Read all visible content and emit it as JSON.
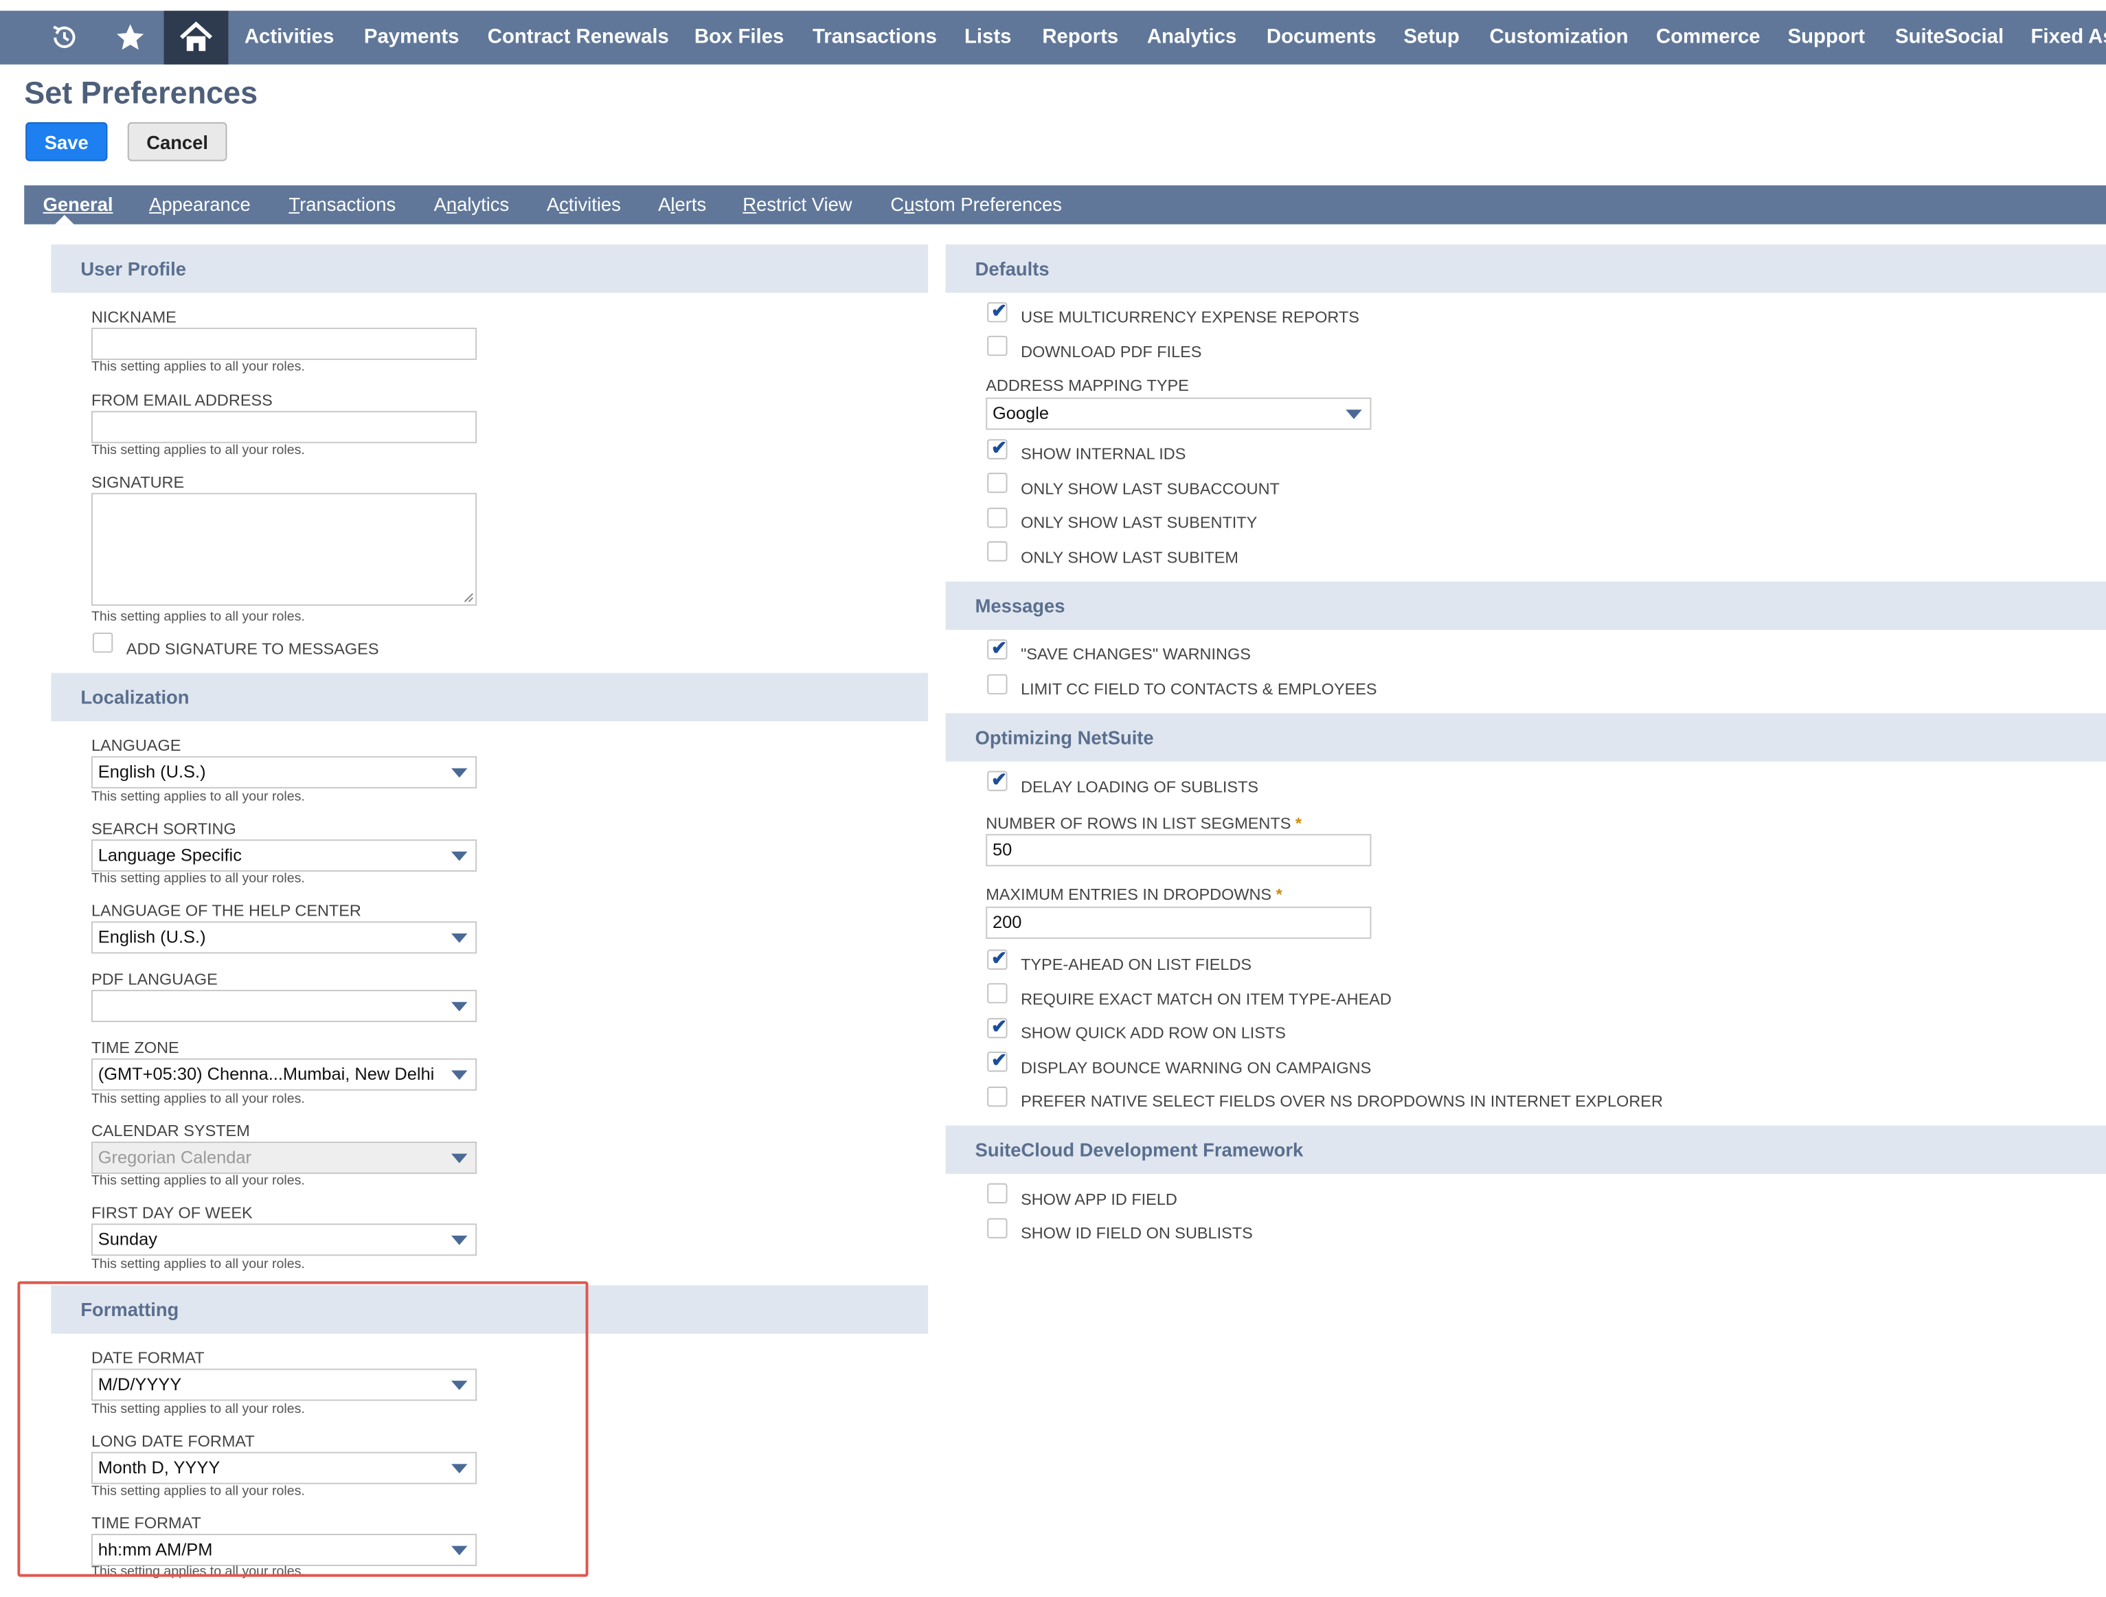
{
  "nav": {
    "icons": [
      "recent-icon",
      "star-icon",
      "home-icon"
    ],
    "items": [
      "Activities",
      "Payments",
      "Contract Renewals",
      "Box Files",
      "Transactions",
      "Lists",
      "Reports",
      "Analytics",
      "Documents",
      "Setup",
      "Customization",
      "Commerce",
      "Support",
      "SuiteSocial",
      "Fixed As"
    ]
  },
  "page": {
    "title": "Set Preferences",
    "save_label": "Save",
    "cancel_label": "Cancel"
  },
  "tabs": [
    {
      "label": "General",
      "underline": "G",
      "rest": "eneral",
      "active": true
    },
    {
      "label": "Appearance",
      "underline": "A",
      "rest": "ppearance"
    },
    {
      "label": "Transactions",
      "underline": "T",
      "rest": "ransactions"
    },
    {
      "label": "Analytics",
      "pre": "A",
      "underline": "n",
      "rest": "alytics"
    },
    {
      "label": "Activities",
      "pre": "A",
      "underline": "c",
      "rest": "tivities"
    },
    {
      "label": "Alerts",
      "pre": "A",
      "underline": "l",
      "rest": "erts"
    },
    {
      "label": "Restrict View",
      "underline": "R",
      "rest": "estrict View"
    },
    {
      "label": "Custom Preferences",
      "pre": "C",
      "underline": "u",
      "rest": "stom Preferences"
    }
  ],
  "sections": {
    "user_profile": "User Profile",
    "localization": "Localization",
    "formatting": "Formatting",
    "defaults": "Defaults",
    "messages": "Messages",
    "optimizing": "Optimizing NetSuite",
    "suitecloud": "SuiteCloud Development Framework"
  },
  "role_note": "This setting applies to all your roles.",
  "user_profile": {
    "nickname_label": "NICKNAME",
    "nickname_value": "",
    "from_email_label": "FROM EMAIL ADDRESS",
    "from_email_value": "",
    "signature_label": "SIGNATURE",
    "signature_value": "",
    "add_signature_label": "ADD SIGNATURE TO MESSAGES",
    "add_signature_checked": false
  },
  "localization": {
    "language_label": "LANGUAGE",
    "language_value": "English (U.S.)",
    "search_sorting_label": "SEARCH SORTING",
    "search_sorting_value": "Language Specific",
    "help_language_label": "LANGUAGE OF THE HELP CENTER",
    "help_language_value": "English (U.S.)",
    "pdf_language_label": "PDF LANGUAGE",
    "pdf_language_value": "",
    "time_zone_label": "TIME ZONE",
    "time_zone_value": "(GMT+05:30) Chenna...Mumbai, New Delhi",
    "calendar_label": "CALENDAR SYSTEM",
    "calendar_value": "Gregorian Calendar",
    "first_day_label": "FIRST DAY OF WEEK",
    "first_day_value": "Sunday"
  },
  "formatting": {
    "date_format_label": "DATE FORMAT",
    "date_format_value": "M/D/YYYY",
    "long_date_label": "LONG DATE FORMAT",
    "long_date_value": "Month D, YYYY",
    "time_format_label": "TIME FORMAT",
    "time_format_value": "hh:mm AM/PM"
  },
  "defaults": {
    "multicurrency_label": "USE MULTICURRENCY EXPENSE REPORTS",
    "multicurrency_checked": true,
    "download_pdf_label": "DOWNLOAD PDF FILES",
    "download_pdf_checked": false,
    "address_mapping_label": "ADDRESS MAPPING TYPE",
    "address_mapping_value": "Google",
    "internal_ids_label": "SHOW INTERNAL IDS",
    "internal_ids_checked": true,
    "last_subaccount_label": "ONLY SHOW LAST SUBACCOUNT",
    "last_subaccount_checked": false,
    "last_subentity_label": "ONLY SHOW LAST SUBENTITY",
    "last_subentity_checked": false,
    "last_subitem_label": "ONLY SHOW LAST SUBITEM",
    "last_subitem_checked": false
  },
  "messages": {
    "save_changes_label": "\"SAVE CHANGES\" WARNINGS",
    "save_changes_checked": true,
    "limit_cc_label": "LIMIT CC FIELD TO CONTACTS & EMPLOYEES",
    "limit_cc_checked": false
  },
  "optimizing": {
    "delay_sublists_label": "DELAY LOADING OF SUBLISTS",
    "delay_sublists_checked": true,
    "rows_label": "NUMBER OF ROWS IN LIST SEGMENTS",
    "rows_value": "50",
    "max_entries_label": "MAXIMUM ENTRIES IN DROPDOWNS",
    "max_entries_value": "200",
    "required_mark": "*",
    "type_ahead_label": "TYPE-AHEAD ON LIST FIELDS",
    "type_ahead_checked": true,
    "exact_match_label": "REQUIRE EXACT MATCH ON ITEM TYPE-AHEAD",
    "exact_match_checked": false,
    "quick_add_label": "SHOW QUICK ADD ROW ON LISTS",
    "quick_add_checked": true,
    "bounce_warning_label": "DISPLAY BOUNCE WARNING ON CAMPAIGNS",
    "bounce_warning_checked": true,
    "native_select_label": "PREFER NATIVE SELECT FIELDS OVER NS DROPDOWNS IN INTERNET EXPLORER",
    "native_select_checked": false
  },
  "suitecloud": {
    "app_id_label": "SHOW APP ID FIELD",
    "app_id_checked": false,
    "id_sublists_label": "SHOW ID FIELD ON SUBLISTS",
    "id_sublists_checked": false
  },
  "colors": {
    "nav_bg": "#607799",
    "home_bg": "#2e3a4e",
    "save_blue": "#1d7ff0",
    "section_bg": "#e0e6ef",
    "highlight": "#e0574f"
  }
}
